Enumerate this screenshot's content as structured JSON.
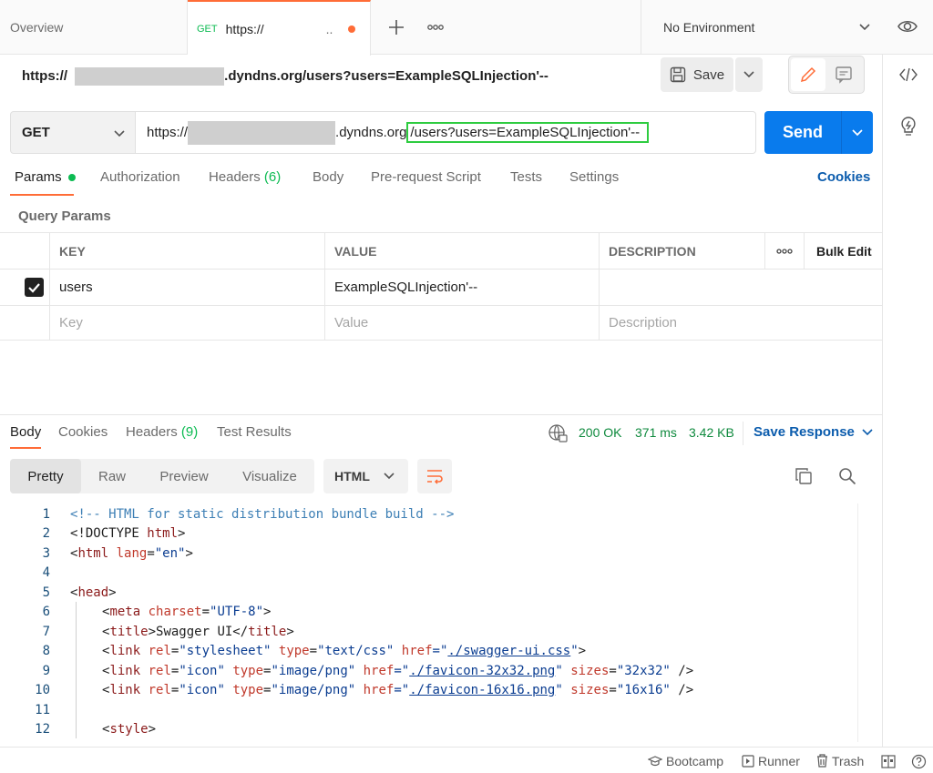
{
  "tabs": {
    "overview": "Overview",
    "active_method": "GET",
    "active_title": "https://",
    "active_trunc": ".."
  },
  "environment": "No Environment",
  "request": {
    "title_prefix": "https://",
    "title_suffix": ".dyndns.org/users?users=ExampleSQLInjection'--",
    "save_label": "Save",
    "method": "GET",
    "url_prefix": "https://",
    "url_host_suffix": ".dyndns.org",
    "url_path": "/users?users=ExampleSQLInjection'--",
    "send_label": "Send"
  },
  "request_tabs": {
    "params": "Params",
    "authorization": "Authorization",
    "headers": "Headers",
    "headers_count": "(6)",
    "body": "Body",
    "prerequest": "Pre-request Script",
    "tests": "Tests",
    "settings": "Settings",
    "cookies": "Cookies"
  },
  "query_params": {
    "title": "Query Params",
    "columns": [
      "KEY",
      "VALUE",
      "DESCRIPTION"
    ],
    "more": "ooo",
    "bulk_edit": "Bulk Edit",
    "rows": [
      {
        "key": "users",
        "value": "ExampleSQLInjection'--",
        "description": "",
        "checked": true
      }
    ],
    "placeholder": {
      "key": "Key",
      "value": "Value",
      "description": "Description"
    }
  },
  "response": {
    "tabs": {
      "body": "Body",
      "cookies": "Cookies",
      "headers": "Headers",
      "headers_count": "(9)",
      "tests": "Test Results"
    },
    "status": "200 OK",
    "time": "371 ms",
    "size": "3.42 KB",
    "save_response": "Save Response",
    "formats": [
      "Pretty",
      "Raw",
      "Preview",
      "Visualize"
    ],
    "language": "HTML"
  },
  "code_lines": [
    {
      "n": "1"
    },
    {
      "n": "2"
    },
    {
      "n": "3"
    },
    {
      "n": "4"
    },
    {
      "n": "5"
    },
    {
      "n": "6"
    },
    {
      "n": "7"
    },
    {
      "n": "8"
    },
    {
      "n": "9"
    },
    {
      "n": "10"
    },
    {
      "n": "11"
    },
    {
      "n": "12"
    }
  ],
  "code": {
    "l1": "<!-- HTML for static distribution bundle build -->",
    "l2_a": "<!DOCTYPE ",
    "l2_b": "html",
    "l2_c": ">",
    "l3_a": "<",
    "l3_b": "html",
    "l3_c": " lang",
    "l3_d": "=",
    "l3_e": "\"en\"",
    "l3_f": ">",
    "l5_a": "<",
    "l5_b": "head",
    "l5_c": ">",
    "l6_a": "<",
    "l6_b": "meta",
    "l6_c": " charset",
    "l6_d": "=",
    "l6_e": "\"UTF-8\"",
    "l6_f": ">",
    "l7_a": "<",
    "l7_b": "title",
    "l7_c": ">Swagger UI</",
    "l7_d": "title",
    "l7_e": ">",
    "l8_a": "<",
    "l8_b": "link",
    "l8_c": " rel",
    "l8_d": "=",
    "l8_e": "\"stylesheet\"",
    "l8_f": " type",
    "l8_g": "=",
    "l8_h": "\"text/css\"",
    "l8_i": " href",
    "l8_j": "=\"",
    "l8_k": "./swagger-ui.css",
    "l8_l": "\"",
    "l8_m": ">",
    "l9_a": "<",
    "l9_b": "link",
    "l9_c": " rel",
    "l9_d": "=",
    "l9_e": "\"icon\"",
    "l9_f": " type",
    "l9_g": "=",
    "l9_h": "\"image/png\"",
    "l9_i": " href",
    "l9_j": "=\"",
    "l9_k": "./favicon-32x32.png",
    "l9_l": "\"",
    "l9_m": " sizes",
    "l9_n": "=",
    "l9_o": "\"32x32\"",
    "l9_p": " />",
    "l10_k": "./favicon-16x16.png",
    "l10_o": "\"16x16\"",
    "l12_a": "<",
    "l12_b": "style",
    "l12_c": ">"
  },
  "statusbar": {
    "bootcamp": "Bootcamp",
    "runner": "Runner",
    "trash": "Trash"
  },
  "colors": {
    "accent": "#ff6c37",
    "primary": "#097bed",
    "success": "#0cbb52"
  }
}
